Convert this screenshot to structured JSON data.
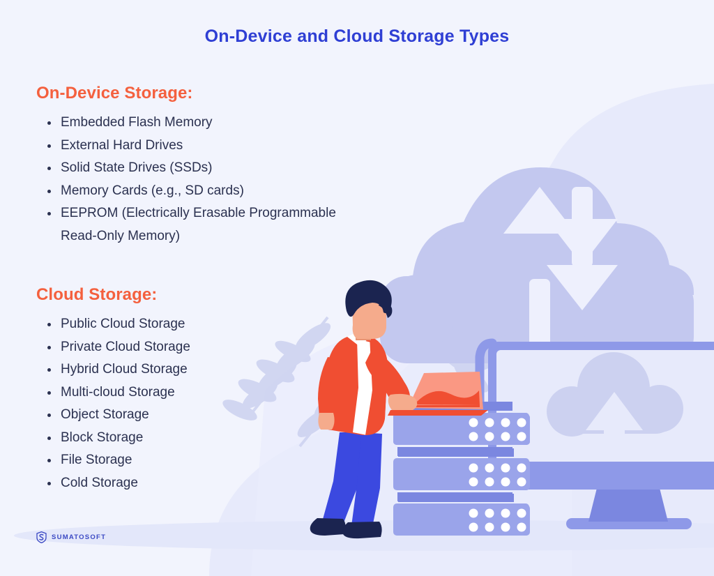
{
  "title": "On-Device and Cloud Storage Types",
  "sections": [
    {
      "heading": "On-Device Storage:",
      "items": [
        "Embedded Flash Memory",
        "External Hard Drives",
        "Solid State Drives (SSDs)",
        "Memory Cards (e.g., SD cards)",
        "EEPROM (Electrically Erasable Programmable Read-Only Memory)"
      ]
    },
    {
      "heading": "Cloud Storage:",
      "items": [
        "Public Cloud Storage",
        "Private Cloud Storage",
        "Hybrid Cloud Storage",
        "Multi-cloud Storage",
        "Object Storage",
        "Block Storage",
        "File Storage",
        "Cold Storage"
      ]
    }
  ],
  "logo": {
    "text": "SUMATOSOFT",
    "mark": "shield-s-icon"
  },
  "illustration": {
    "elements": [
      "cloud-sync-graphic",
      "upload-arrow-icon",
      "download-arrow-icon",
      "person-graphic",
      "laptop-graphic",
      "server-rack-graphic",
      "monitor-graphic",
      "cloud-upload-icon",
      "leaf-decoration",
      "background-blob",
      "ground-shadow"
    ]
  },
  "colors": {
    "background": "#f2f4fd",
    "title_blue": "#2f3fd4",
    "heading_orange": "#f4603e",
    "body_text": "#2b3150",
    "illustration_periwinkle": "#c3c8ef",
    "illustration_blue": "#9aa4ea",
    "illustration_blue_dark": "#7b87e0",
    "accent_red": "#f04e32",
    "accent_salmon": "#fa9883",
    "pants_blue": "#3b49e0",
    "hair_navy": "#1b2450",
    "skin": "#f5ab8c",
    "logo_blue": "#3b49c4"
  }
}
